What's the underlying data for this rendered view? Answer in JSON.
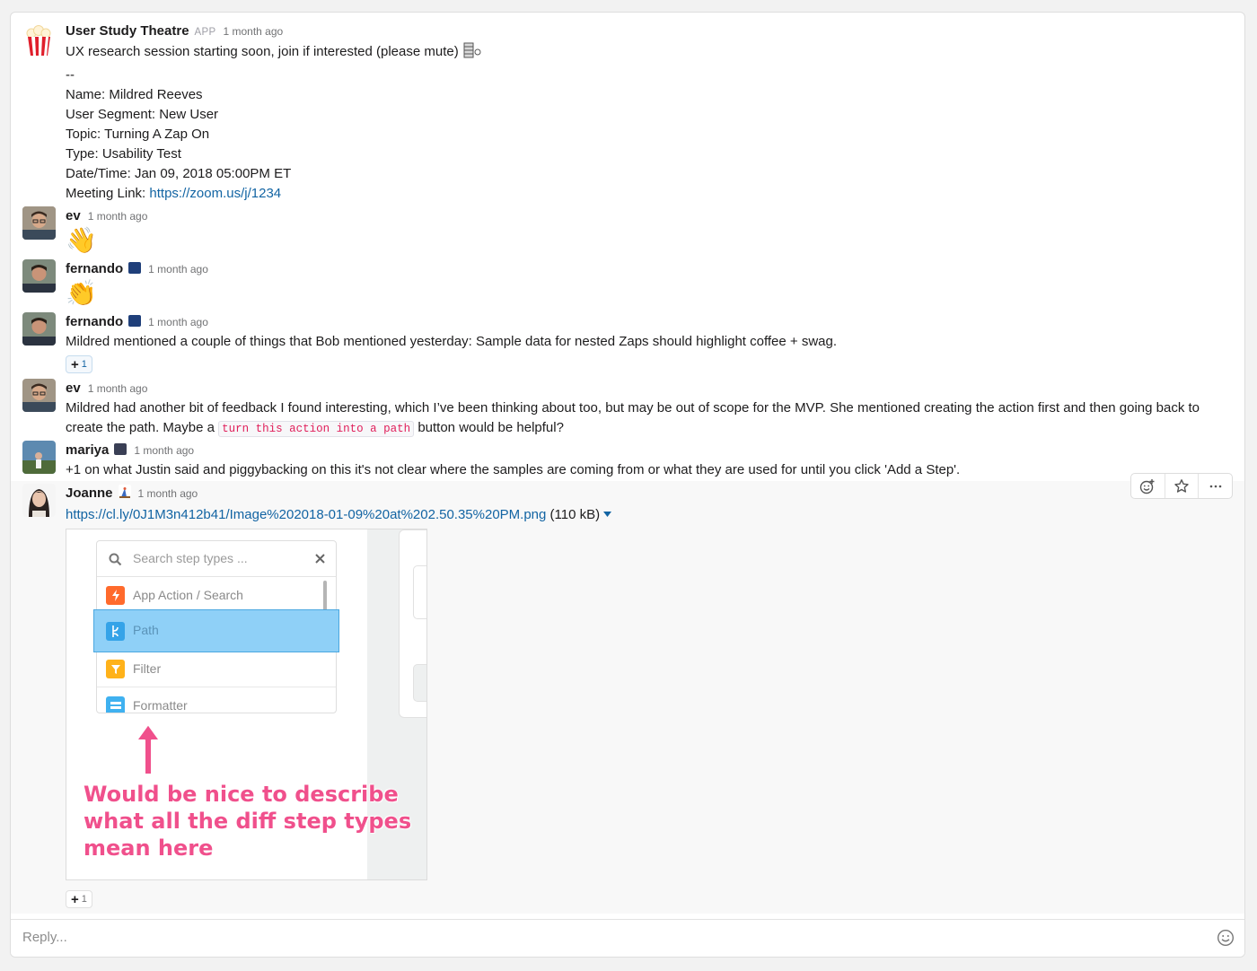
{
  "messages": [
    {
      "author": "User Study Theatre",
      "app_tag": "APP",
      "time": "1 month ago",
      "lines": {
        "intro": "UX research session starting soon, join if interested (please mute)",
        "sep": "--",
        "name": "Name: Mildred Reeves",
        "segment": "User Segment: New User",
        "topic": "Topic: Turning A Zap On",
        "type": "Type: Usability Test",
        "datetime": "Date/Time: Jan 09, 2018 05:00PM ET",
        "meeting_label": "Meeting Link: ",
        "meeting_url": "https://zoom.us/j/1234"
      }
    },
    {
      "author": "ev",
      "time": "1 month ago",
      "emoji": "👋"
    },
    {
      "author": "fernando",
      "time": "1 month ago",
      "emoji": "👏"
    },
    {
      "author": "fernando",
      "time": "1 month ago",
      "text": "Mildred mentioned a couple of things that Bob mentioned yesterday: Sample data for nested Zaps should highlight coffee + swag.",
      "reaction_count": "1"
    },
    {
      "author": "ev",
      "time": "1 month ago",
      "text_a": "Mildred had another bit of feedback I found interesting, which I’ve been thinking about too, but may be out of scope for the MVP. She mentioned creating the action first and then going back to create the path. Maybe a ",
      "code": "turn this action into a path",
      "text_b": " button would be helpful?"
    },
    {
      "author": "mariya",
      "time": "1 month ago",
      "text": "+1 on what Justin said and piggybacking on this it's not clear where the samples are coming from or what they are used for until you click 'Add a Step'."
    },
    {
      "author": "Joanne",
      "time": "1 month ago",
      "file_url": "https://cl.ly/0J1M3n412b41/Image%202018-01-09%20at%202.50.35%20PM.png",
      "file_size": "(110 kB)",
      "reaction_count": "1",
      "preview": {
        "search_placeholder": "Search step types ...",
        "items": [
          "App Action / Search",
          "Path",
          "Filter",
          "Formatter"
        ],
        "annotation_1": "Would be nice to describe",
        "annotation_2": "what all the diff step types",
        "annotation_3": "mean here"
      }
    }
  ],
  "reply_placeholder": "Reply...",
  "colors": {
    "link": "#1264a3",
    "highlight": "#8fd0f7",
    "annotation": "#f0508c"
  }
}
